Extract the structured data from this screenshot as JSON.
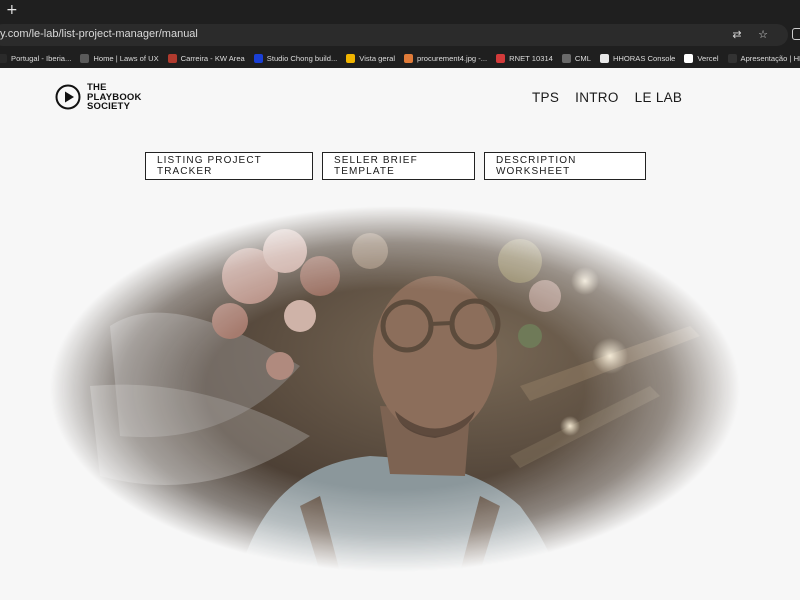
{
  "browser": {
    "new_tab": "+",
    "url": "y.com/le-lab/list-project-manager/manual",
    "icons": [
      "translate-icon",
      "star-icon",
      "extensions-icon"
    ],
    "bookmarks": [
      {
        "label": "Portugal - Iberia...",
        "color": "#2a2a2a"
      },
      {
        "label": "Home | Laws of UX",
        "color": "#5a5a5a"
      },
      {
        "label": "Carreira - KW Area",
        "color": "#b03a2e"
      },
      {
        "label": "Studio Chong build...",
        "color": "#1a3fd6"
      },
      {
        "label": "Vista geral",
        "color": "#f0b400"
      },
      {
        "label": "procurement4.jpg -...",
        "color": "#e07b39"
      },
      {
        "label": "RNET 10314",
        "color": "#d23a3a"
      },
      {
        "label": "CML",
        "color": "#6a6a6a"
      },
      {
        "label": "HHORAS Console",
        "color": "#e8e8e8"
      },
      {
        "label": "Vercel",
        "color": "#ffffff"
      },
      {
        "label": "Apresentação | HH...",
        "color": "#333333"
      }
    ]
  },
  "site": {
    "logo_lines": [
      "THE",
      "PLAYBOOK",
      "SOCIETY"
    ],
    "nav": [
      "TPS",
      "INTRO",
      "LE LAB"
    ],
    "buttons": [
      "LISTING PROJECT TRACKER",
      "SELLER BRIEF TEMPLATE",
      "DESCRIPTION WORKSHEET"
    ]
  },
  "hero": {
    "subject": "portrait of a man with round glasses and a flower crown, vignette fade",
    "colors": {
      "skin": "#8a6f5c",
      "bg_warm": "#6b5a48",
      "flowers": "#b88e84",
      "shirt": "#8c9aa0"
    }
  }
}
